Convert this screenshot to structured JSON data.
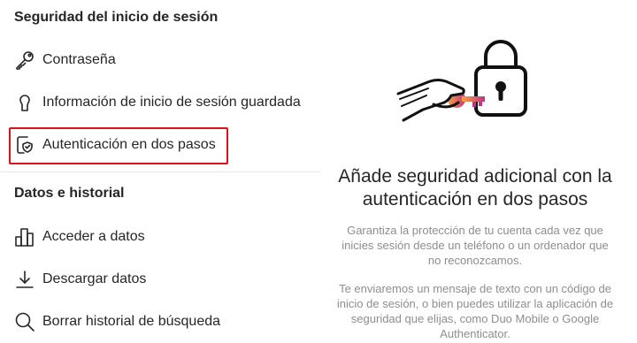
{
  "sections": {
    "login_security": {
      "title": "Seguridad del inicio de sesión",
      "items": [
        {
          "label": "Contraseña",
          "icon": "key-icon"
        },
        {
          "label": "Información de inicio de sesión guardada",
          "icon": "saved-login-icon"
        },
        {
          "label": "Autenticación en dos pasos",
          "icon": "phone-shield-icon",
          "highlighted": true
        }
      ]
    },
    "data_history": {
      "title": "Datos e historial",
      "items": [
        {
          "label": "Acceder a datos",
          "icon": "bar-chart-icon"
        },
        {
          "label": "Descargar datos",
          "icon": "download-icon"
        },
        {
          "label": "Borrar historial de búsqueda",
          "icon": "search-icon"
        }
      ]
    }
  },
  "detail": {
    "headline": "Añade seguridad adicional con la autenticación en dos pasos",
    "paragraph1": "Garantiza la protección de tu cuenta cada vez que inicies sesión desde un teléfono o un ordenador que no reconozcamos.",
    "paragraph2": "Te enviaremos un mensaje de texto con un código de inicio de sesión, o bien puedes utilizar la aplicación de seguridad que elijas, como Duo Mobile o Google Authenticator.",
    "illustration_icon": "hand-key-padlock-icon"
  },
  "colors": {
    "highlight_border": "#e0101a",
    "text_primary": "#262626",
    "text_secondary": "#8e8e8e",
    "key_gradient_start": "#f9a03f",
    "key_gradient_end": "#c13584"
  }
}
